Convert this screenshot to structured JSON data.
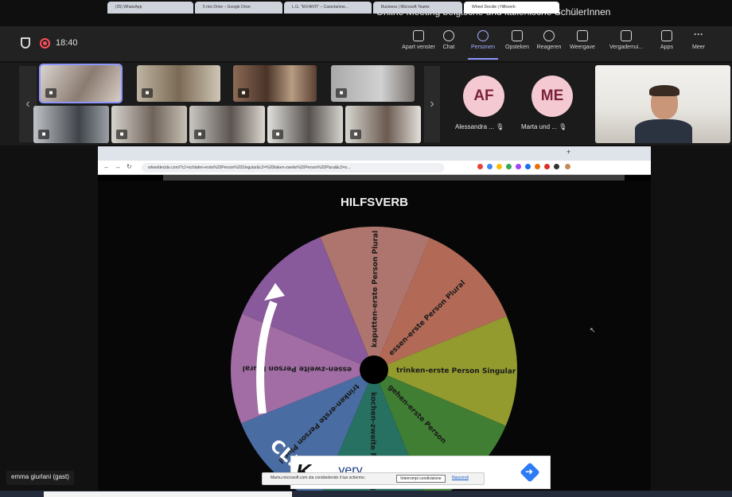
{
  "meeting": {
    "title": "Online Meeting belgische und italienische SchülerInnen",
    "time": "18:40"
  },
  "toolbar": {
    "items": [
      {
        "label": "Apart venster",
        "icon": "popout-icon"
      },
      {
        "label": "Chat",
        "icon": "chat-icon"
      },
      {
        "label": "Personen",
        "icon": "people-icon",
        "active": true
      },
      {
        "label": "Opsteken",
        "icon": "raise-hand-icon"
      },
      {
        "label": "Reageren",
        "icon": "smile-icon"
      },
      {
        "label": "Weergave",
        "icon": "grid-icon"
      },
      {
        "label": "Vergaderrui...",
        "icon": "rooms-icon"
      },
      {
        "label": "Apps",
        "icon": "add-icon"
      },
      {
        "label": "Meer",
        "icon": "more-icon"
      }
    ],
    "accent": "#8d96ff"
  },
  "participants": {
    "named": [
      {
        "initials": "AF",
        "name": "Alessandra ..."
      },
      {
        "initials": "ME",
        "name": "Marta und ..."
      }
    ],
    "avatar_color": "#f4c9d2"
  },
  "browser": {
    "tabs": [
      "(35) WhatsApp",
      "5 mix Drive – Google Drive",
      "L.G. \"M.FANTI\" – Caserta/one...",
      "Business | Microsoft Teams",
      "Wheel Decide | Hilfsverb"
    ],
    "new_tab": "+",
    "url": "wheeldecide.com/?c1=schlafen-erste%20Person%20Singular&c2=%20itaken-zweite%20Person%20Plural&c3=s..."
  },
  "wheel": {
    "title": "HILFSVERB",
    "segments": [
      {
        "label": "kaputten-erste Person Plural",
        "color": "#d48f86"
      },
      {
        "label": "essen-erste Person Plural",
        "color": "#d9826b"
      },
      {
        "label": "trinken-erste Person Singular",
        "color": "#b4bd3a"
      },
      {
        "label": "gehen-erste Person",
        "color": "#4f9a3f"
      },
      {
        "label": "kochen-zweite Person Singular",
        "color": "#2f8a77"
      },
      {
        "label": "trinken-erste Person Plural",
        "color": "#5a84c6"
      },
      {
        "label": "essen-zweite Person Plural",
        "color": "#c586c8"
      },
      {
        "label": "",
        "color": "#a66dbd"
      }
    ],
    "arrow_text": "CLIC",
    "hub_color": "#000000"
  },
  "ad": {
    "text": "...yery"
  },
  "share_bar": {
    "message": "Mamu.microsoft.com sta condividendo il tuo schermo.",
    "stop": "Interrompi condivisione",
    "hide": "Nascondi"
  },
  "gast_label": "emma giurlani (gast)"
}
